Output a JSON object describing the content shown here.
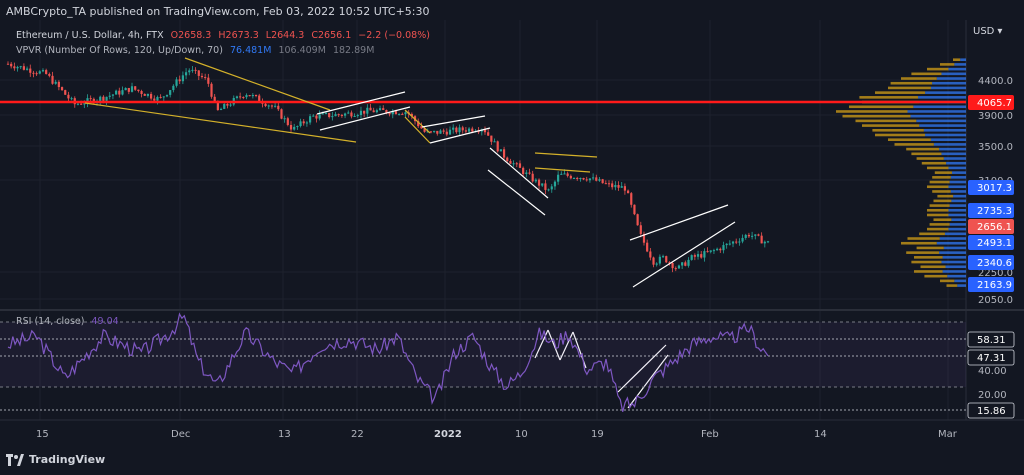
{
  "header": {
    "publisher": "AMBCrypto_TA published on TradingView.com, Feb 03, 2022 10:52 UTC+5:30"
  },
  "currency": "USD",
  "footer": {
    "brand": "TradingView"
  },
  "legend": {
    "symbol": "Ethereum / U.S. Dollar, 4h, FTX",
    "o": "O2658.3",
    "h": "H2673.3",
    "l": "L2644.3",
    "c": "C2656.1",
    "chg": "−2.2 (−0.08%)",
    "vpvr_label": "VPVR (Number Of Rows, 120, Up/Down, 70)",
    "vpvr_v1": "76.481M",
    "vpvr_v2": "106.409M",
    "vpvr_v3": "182.89M",
    "rsi_label": "RSI (14, close)",
    "rsi_value": "49.04"
  },
  "colors": {
    "bg": "#131722",
    "up": "#26a69a",
    "down": "#ef5350",
    "resistance": "#ff1a1a",
    "rsi": "#7e57c2",
    "badge_blue": "#2962ff",
    "pattern": "#ffffff",
    "wedge": "#d4b12a",
    "vp_up": "#3179f5",
    "vp_down": "#d4a017"
  },
  "chart_data": [
    {
      "type": "candlestick",
      "title": "Ethereum / U.S. Dollar, 4h, FTX",
      "x_ticks": [
        "15",
        "Dec",
        "13",
        "22",
        "2022",
        "10",
        "19",
        "Feb",
        "14",
        "Mar"
      ],
      "y_ticks": [
        "4400.0",
        "3900.0",
        "3500.0",
        "3100.0",
        "2250.0",
        "2050.0"
      ],
      "ylim": [
        1950,
        4700
      ],
      "horizontal_line": {
        "label": "4065.7",
        "value": 4065.7
      },
      "level_labels": [
        "3017.3",
        "2735.3",
        "2493.1",
        "2340.6",
        "2163.9"
      ],
      "level_values": [
        3017.3,
        2735.3,
        2493.1,
        2340.6,
        2163.9
      ],
      "current_price": {
        "label": "2656.1",
        "value": 2656.1
      },
      "close_path": [
        {
          "t": 0,
          "v": 4560
        },
        {
          "t": 0.04,
          "v": 4450
        },
        {
          "t": 0.07,
          "v": 4130
        },
        {
          "t": 0.1,
          "v": 4200
        },
        {
          "t": 0.13,
          "v": 4300
        },
        {
          "t": 0.16,
          "v": 4180
        },
        {
          "t": 0.19,
          "v": 4500
        },
        {
          "t": 0.21,
          "v": 4380
        },
        {
          "t": 0.22,
          "v": 4050
        },
        {
          "t": 0.25,
          "v": 4250
        },
        {
          "t": 0.28,
          "v": 4100
        },
        {
          "t": 0.3,
          "v": 3860
        },
        {
          "t": 0.32,
          "v": 4000
        },
        {
          "t": 0.35,
          "v": 4020
        },
        {
          "t": 0.38,
          "v": 4060
        },
        {
          "t": 0.42,
          "v": 4050
        },
        {
          "t": 0.44,
          "v": 3820
        },
        {
          "t": 0.47,
          "v": 3850
        },
        {
          "t": 0.5,
          "v": 3880
        },
        {
          "t": 0.52,
          "v": 3600
        },
        {
          "t": 0.55,
          "v": 3350
        },
        {
          "t": 0.57,
          "v": 3200
        },
        {
          "t": 0.58,
          "v": 3380
        },
        {
          "t": 0.61,
          "v": 3350
        },
        {
          "t": 0.635,
          "v": 3260
        },
        {
          "t": 0.65,
          "v": 3240
        },
        {
          "t": 0.665,
          "v": 2750
        },
        {
          "t": 0.68,
          "v": 2450
        },
        {
          "t": 0.69,
          "v": 2500
        },
        {
          "t": 0.705,
          "v": 2380
        },
        {
          "t": 0.72,
          "v": 2500
        },
        {
          "t": 0.74,
          "v": 2560
        },
        {
          "t": 0.76,
          "v": 2650
        },
        {
          "t": 0.78,
          "v": 2750
        },
        {
          "t": 0.79,
          "v": 2700
        },
        {
          "t": 0.8,
          "v": 2656
        }
      ],
      "vpvr_levels": [
        2200,
        2250,
        2300,
        2350,
        2400,
        2450,
        2500,
        2550,
        2600,
        2650,
        2700,
        2750,
        2800,
        2850,
        2900,
        2950,
        3000,
        3050,
        3100,
        3150,
        3200,
        3250,
        3300,
        3350,
        3400,
        3450,
        3500,
        3550,
        3600,
        3650,
        3700,
        3750,
        3800,
        3850,
        3900,
        3950,
        4000,
        4050,
        4100,
        4150,
        4200,
        4250,
        4300,
        4350,
        4400,
        4450,
        4500,
        4550,
        4600
      ],
      "vpvr_volumes": [
        0.15,
        0.2,
        0.32,
        0.4,
        0.35,
        0.42,
        0.4,
        0.46,
        0.38,
        0.5,
        0.45,
        0.36,
        0.3,
        0.28,
        0.25,
        0.3,
        0.3,
        0.28,
        0.25,
        0.22,
        0.26,
        0.3,
        0.28,
        0.26,
        0.24,
        0.3,
        0.34,
        0.38,
        0.42,
        0.46,
        0.55,
        0.6,
        0.7,
        0.72,
        0.8,
        0.85,
        0.95,
        1.0,
        0.9,
        0.8,
        0.82,
        0.7,
        0.6,
        0.58,
        0.5,
        0.42,
        0.3,
        0.2,
        0.1
      ]
    },
    {
      "type": "line",
      "title": "RSI (14, close)",
      "ylim": [
        12,
        85
      ],
      "y_ticks": [
        "40.00",
        "20.00"
      ],
      "level_labels": [
        "58.31",
        "47.31",
        "15.86"
      ],
      "level_values": [
        58.31,
        47.31,
        15.86
      ],
      "bands": [
        70,
        30
      ],
      "rsi_path": [
        {
          "t": 0,
          "v": 55
        },
        {
          "t": 0.03,
          "v": 60
        },
        {
          "t": 0.06,
          "v": 35
        },
        {
          "t": 0.1,
          "v": 60
        },
        {
          "t": 0.14,
          "v": 50
        },
        {
          "t": 0.17,
          "v": 62
        },
        {
          "t": 0.185,
          "v": 72
        },
        {
          "t": 0.2,
          "v": 45
        },
        {
          "t": 0.22,
          "v": 30
        },
        {
          "t": 0.25,
          "v": 62
        },
        {
          "t": 0.28,
          "v": 45
        },
        {
          "t": 0.3,
          "v": 38
        },
        {
          "t": 0.33,
          "v": 55
        },
        {
          "t": 0.36,
          "v": 58
        },
        {
          "t": 0.39,
          "v": 52
        },
        {
          "t": 0.41,
          "v": 60
        },
        {
          "t": 0.43,
          "v": 35
        },
        {
          "t": 0.45,
          "v": 22
        },
        {
          "t": 0.47,
          "v": 50
        },
        {
          "t": 0.49,
          "v": 60
        },
        {
          "t": 0.51,
          "v": 40
        },
        {
          "t": 0.525,
          "v": 30
        },
        {
          "t": 0.54,
          "v": 38
        },
        {
          "t": 0.56,
          "v": 62
        },
        {
          "t": 0.575,
          "v": 55
        },
        {
          "t": 0.59,
          "v": 62
        },
        {
          "t": 0.61,
          "v": 40
        },
        {
          "t": 0.63,
          "v": 45
        },
        {
          "t": 0.645,
          "v": 18
        },
        {
          "t": 0.66,
          "v": 20
        },
        {
          "t": 0.68,
          "v": 35
        },
        {
          "t": 0.7,
          "v": 45
        },
        {
          "t": 0.72,
          "v": 55
        },
        {
          "t": 0.74,
          "v": 60
        },
        {
          "t": 0.76,
          "v": 58
        },
        {
          "t": 0.78,
          "v": 65
        },
        {
          "t": 0.79,
          "v": 55
        },
        {
          "t": 0.8,
          "v": 49
        }
      ]
    }
  ]
}
